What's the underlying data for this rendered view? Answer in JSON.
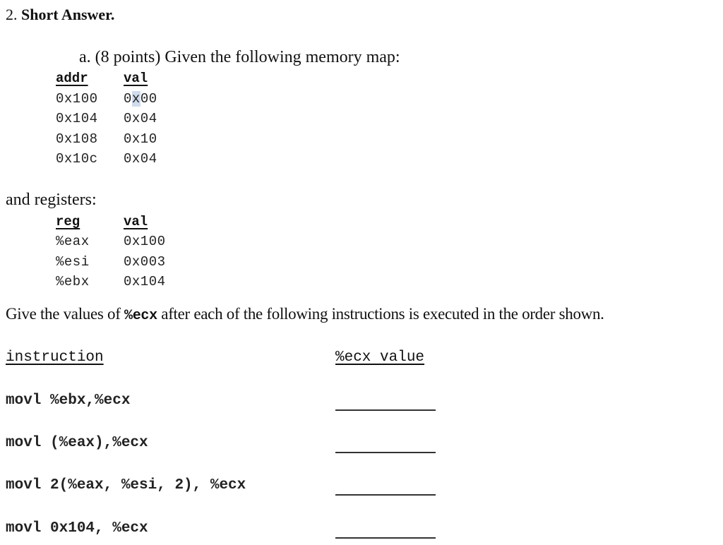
{
  "section": {
    "number": "2.",
    "title": "Short Answer."
  },
  "question": {
    "label": "a.",
    "points": "(8 points)",
    "prompt": "Given the following memory map:"
  },
  "memory_map": {
    "headers": [
      "addr",
      "val"
    ],
    "rows": [
      {
        "addr": "0x100",
        "val_pre": "0",
        "val_hl": "x",
        "val_post": "00"
      },
      {
        "addr": "0x104",
        "val": "0x04"
      },
      {
        "addr": "0x108",
        "val": "0x10"
      },
      {
        "addr": "0x10c",
        "val": "0x04"
      }
    ]
  },
  "registers_intro": "and registers:",
  "registers": {
    "headers": [
      "reg",
      "val"
    ],
    "rows": [
      {
        "reg": "%eax",
        "val": "0x100"
      },
      {
        "reg": "%esi",
        "val": "0x003"
      },
      {
        "reg": "%ebx",
        "val": "0x104"
      }
    ]
  },
  "instructions_prompt": {
    "pre": "Give the values of ",
    "reg": "%ecx",
    "post": " after each of the following instructions is executed in the order shown."
  },
  "answer_table": {
    "headers": [
      "instruction",
      "%ecx value"
    ],
    "rows": [
      {
        "instruction": "movl %ebx,%ecx",
        "answer": ""
      },
      {
        "instruction": "movl (%eax),%ecx",
        "answer": ""
      },
      {
        "instruction": "movl 2(%eax, %esi, 2), %ecx",
        "answer": ""
      },
      {
        "instruction": "movl 0x104, %ecx",
        "answer": ""
      }
    ]
  }
}
